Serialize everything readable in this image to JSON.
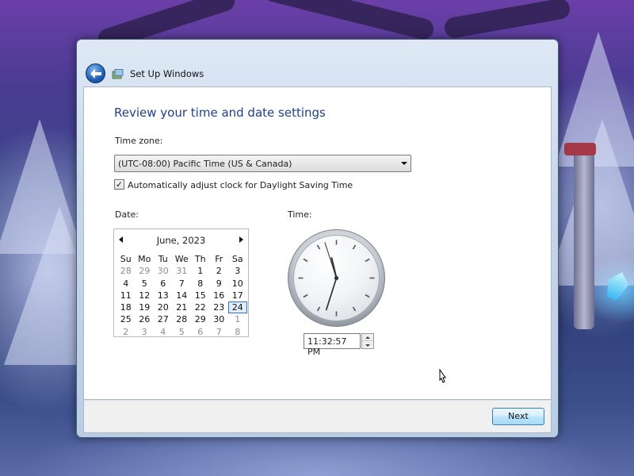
{
  "window": {
    "title": "Set Up Windows"
  },
  "page": {
    "heading": "Review your time and date settings"
  },
  "timezone": {
    "label": "Time zone:",
    "selected": "(UTC-08:00) Pacific Time (US & Canada)"
  },
  "dst": {
    "label": "Automatically adjust clock for Daylight Saving Time",
    "checked": true,
    "check_mark": "✓"
  },
  "date": {
    "label": "Date:",
    "calendar": {
      "month_title": "June, 2023",
      "weekdays": [
        "Su",
        "Mo",
        "Tu",
        "We",
        "Th",
        "Fr",
        "Sa"
      ],
      "weeks": [
        [
          "28",
          "29",
          "30",
          "31",
          "1",
          "2",
          "3"
        ],
        [
          "4",
          "5",
          "6",
          "7",
          "8",
          "9",
          "10"
        ],
        [
          "11",
          "12",
          "13",
          "14",
          "15",
          "16",
          "17"
        ],
        [
          "18",
          "19",
          "20",
          "21",
          "22",
          "23",
          "24"
        ],
        [
          "25",
          "26",
          "27",
          "28",
          "29",
          "30",
          "1"
        ],
        [
          "2",
          "3",
          "4",
          "5",
          "6",
          "7",
          "8"
        ]
      ],
      "selected_day": "24"
    }
  },
  "time": {
    "label": "Time:",
    "value": "11:32:57 PM",
    "hour": 11,
    "minute": 32,
    "second": 57
  },
  "footer": {
    "next_label": "Next"
  },
  "colors": {
    "heading": "#1e3f8a",
    "selection_border": "#2e6fd1"
  }
}
